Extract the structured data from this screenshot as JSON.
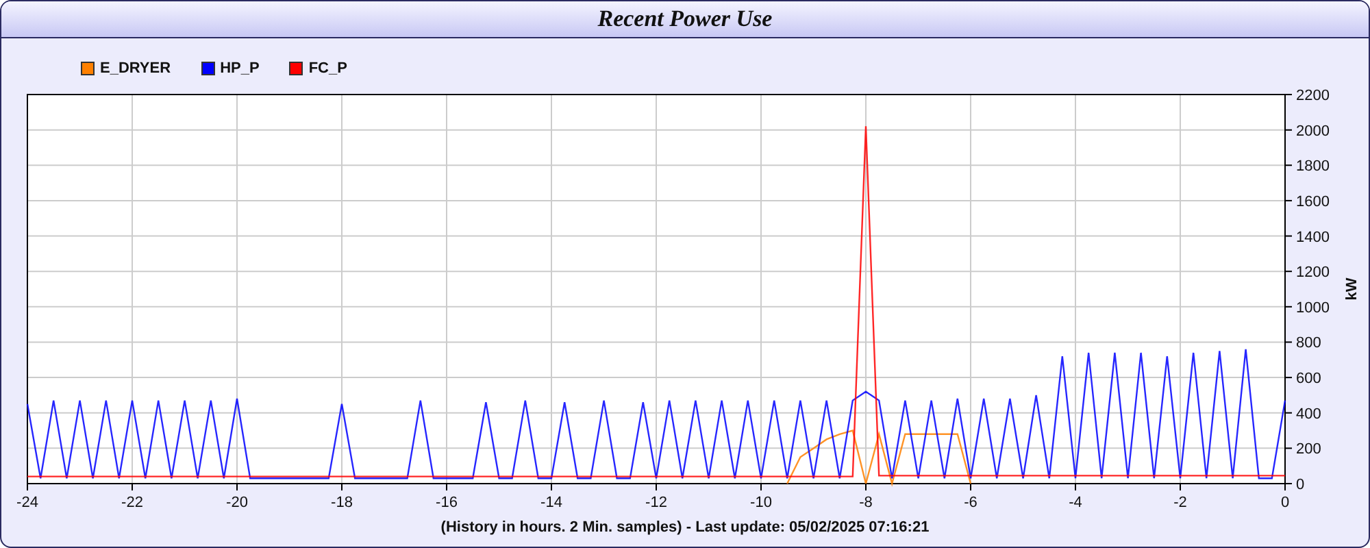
{
  "panel": {
    "title": "Recent Power Use"
  },
  "chart": {
    "chart_data": {
      "type": "line",
      "xlabel": "(History in hours. 2 Min. samples) - Last update: 05/02/2025 07:16:21",
      "ylabel": "kW",
      "x": [
        -24,
        -23.75,
        -23.5,
        -23.25,
        -23,
        -22.75,
        -22.5,
        -22.25,
        -22,
        -21.75,
        -21.5,
        -21.25,
        -21,
        -20.75,
        -20.5,
        -20.25,
        -20,
        -19.75,
        -19.5,
        -19.25,
        -19,
        -18.75,
        -18.5,
        -18.25,
        -18,
        -17.75,
        -17.5,
        -17.25,
        -17,
        -16.75,
        -16.5,
        -16.25,
        -16,
        -15.75,
        -15.5,
        -15.25,
        -15,
        -14.75,
        -14.5,
        -14.25,
        -14,
        -13.75,
        -13.5,
        -13.25,
        -13,
        -12.75,
        -12.5,
        -12.25,
        -12,
        -11.75,
        -11.5,
        -11.25,
        -11,
        -10.75,
        -10.5,
        -10.25,
        -10,
        -9.75,
        -9.5,
        -9.25,
        -9,
        -8.75,
        -8.5,
        -8.25,
        -8,
        -7.75,
        -7.5,
        -7.25,
        -7,
        -6.75,
        -6.5,
        -6.25,
        -6,
        -5.75,
        -5.5,
        -5.25,
        -5,
        -4.75,
        -4.5,
        -4.25,
        -4,
        -3.75,
        -3.5,
        -3.25,
        -3,
        -2.75,
        -2.5,
        -2.25,
        -2,
        -1.75,
        -1.5,
        -1.25,
        -1,
        -0.75,
        -0.5,
        -0.25,
        0
      ],
      "series": [
        {
          "name": "E_DRYER",
          "color": "#ff8000",
          "values": [
            null,
            null,
            null,
            null,
            null,
            null,
            null,
            null,
            null,
            null,
            null,
            null,
            null,
            null,
            null,
            null,
            null,
            null,
            null,
            null,
            null,
            null,
            null,
            null,
            null,
            null,
            null,
            null,
            null,
            null,
            null,
            null,
            null,
            null,
            null,
            null,
            null,
            null,
            null,
            null,
            null,
            null,
            null,
            null,
            null,
            null,
            null,
            null,
            null,
            null,
            null,
            null,
            null,
            null,
            null,
            null,
            null,
            null,
            0,
            150,
            200,
            250,
            280,
            300,
            0,
            280,
            0,
            280,
            280,
            280,
            280,
            280,
            0,
            null,
            null,
            null,
            null,
            null,
            null,
            null,
            null,
            null,
            null,
            null,
            null,
            null,
            null,
            null,
            null,
            null,
            null,
            null,
            null,
            null,
            null,
            null,
            null
          ]
        },
        {
          "name": "HP_P",
          "color": "#0000ff",
          "values": [
            450,
            30,
            470,
            30,
            470,
            30,
            470,
            30,
            470,
            30,
            470,
            30,
            470,
            30,
            470,
            30,
            480,
            30,
            30,
            30,
            30,
            30,
            30,
            30,
            450,
            30,
            30,
            30,
            30,
            30,
            470,
            30,
            30,
            30,
            30,
            460,
            30,
            30,
            470,
            30,
            30,
            460,
            30,
            30,
            470,
            30,
            30,
            460,
            30,
            470,
            30,
            470,
            30,
            470,
            30,
            470,
            30,
            470,
            30,
            470,
            30,
            470,
            30,
            470,
            520,
            470,
            30,
            470,
            30,
            470,
            30,
            480,
            30,
            480,
            30,
            480,
            30,
            500,
            30,
            720,
            30,
            740,
            30,
            740,
            30,
            740,
            30,
            720,
            30,
            740,
            30,
            750,
            30,
            760,
            30,
            30,
            470
          ]
        },
        {
          "name": "FC_P",
          "color": "#ff0000",
          "values": [
            40,
            40,
            40,
            40,
            40,
            40,
            40,
            40,
            40,
            40,
            40,
            40,
            40,
            40,
            40,
            40,
            40,
            40,
            40,
            40,
            40,
            40,
            40,
            40,
            40,
            40,
            40,
            40,
            40,
            40,
            40,
            40,
            40,
            40,
            40,
            40,
            40,
            40,
            40,
            40,
            40,
            40,
            40,
            40,
            40,
            40,
            40,
            40,
            40,
            40,
            40,
            40,
            40,
            40,
            40,
            40,
            40,
            40,
            40,
            40,
            40,
            40,
            40,
            40,
            2020,
            45,
            45,
            45,
            45,
            45,
            45,
            45,
            45,
            45,
            45,
            45,
            45,
            45,
            45,
            45,
            45,
            45,
            45,
            45,
            45,
            45,
            45,
            45,
            45,
            45,
            45,
            45,
            45,
            45,
            45,
            45,
            45
          ]
        }
      ],
      "grid": true,
      "xlim": [
        -24,
        0
      ],
      "ylim": [
        0,
        2200
      ],
      "xticks": [
        -24,
        -22,
        -20,
        -18,
        -16,
        -14,
        -12,
        -10,
        -8,
        -6,
        -4,
        -2,
        0
      ],
      "yticks": [
        0,
        200,
        400,
        600,
        800,
        1000,
        1200,
        1400,
        1600,
        1800,
        2000,
        2200
      ]
    }
  }
}
